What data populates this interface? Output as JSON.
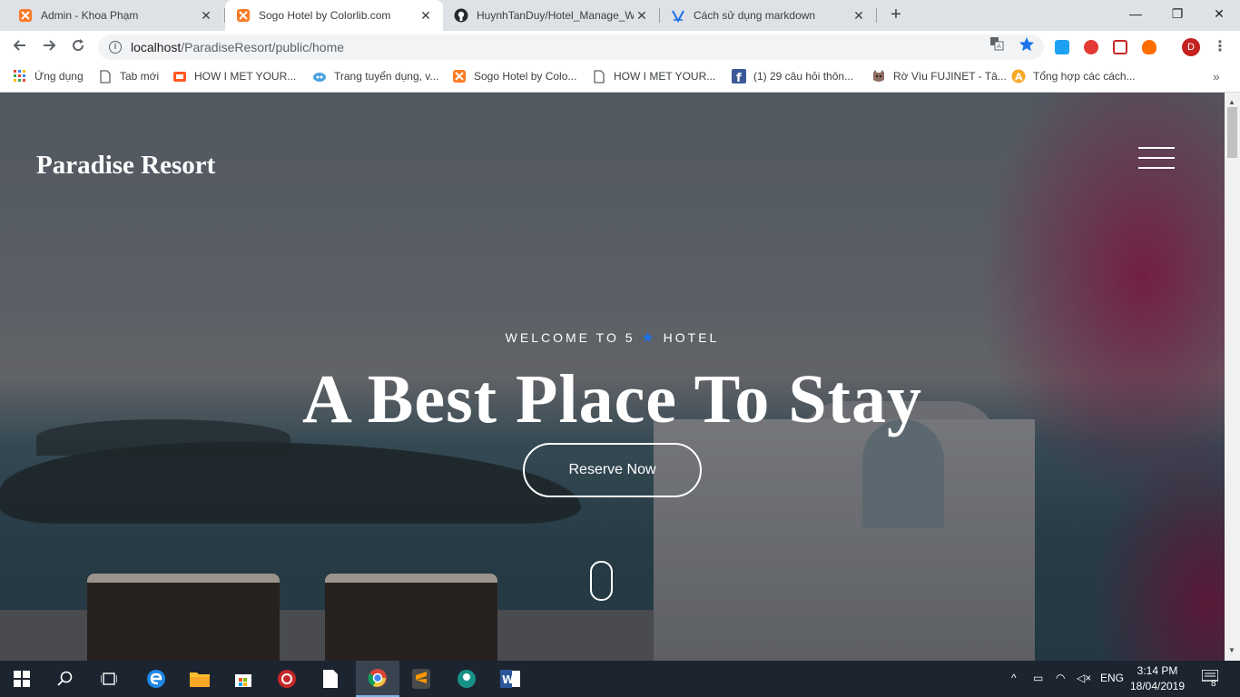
{
  "browser": {
    "tabs": [
      {
        "title": "Admin - Khoa Phạm",
        "favicon": "xampp-icon",
        "active": false
      },
      {
        "title": "Sogo Hotel by Colorlib.com",
        "favicon": "xampp-icon",
        "active": true
      },
      {
        "title": "HuynhTanDuy/Hotel_Manage_We",
        "favicon": "github-icon",
        "active": false
      },
      {
        "title": "Cách sử dụng markdown",
        "favicon": "viblo-icon",
        "active": false
      }
    ],
    "tab_close": "✕",
    "new_tab": "+",
    "window_controls": {
      "minimize": "—",
      "maximize": "❐",
      "close": "✕"
    },
    "url_host": "localhost",
    "url_path": "/ParadiseResort/public/home",
    "profile_initial": "D",
    "bookmarks": [
      {
        "label": "Ứng dụng",
        "icon": "apps-grid-icon"
      },
      {
        "label": "Tab mới",
        "icon": "page-icon"
      },
      {
        "label": "HOW I MET YOUR...",
        "icon": "film-icon"
      },
      {
        "label": "Trang tuyển dụng, v...",
        "icon": "cloud-icon"
      },
      {
        "label": "Sogo Hotel by Colo...",
        "icon": "xampp-icon"
      },
      {
        "label": "HOW I MET YOUR...",
        "icon": "page-icon"
      },
      {
        "label": "(1) 29 câu hỏi thôn...",
        "icon": "facebook-icon"
      },
      {
        "label": "Rờ Vìu FUJINET - Tâ...",
        "icon": "cat-icon"
      },
      {
        "label": "Tổng hợp các cách...",
        "icon": "a-badge-icon"
      }
    ],
    "bookmarks_more": "»"
  },
  "page": {
    "brand": "Paradise Resort",
    "welcome_prefix": "WELCOME TO 5",
    "welcome_star": "★",
    "welcome_suffix": "HOTEL",
    "headline": "A Best Place To Stay",
    "reserve_label": "Reserve Now"
  },
  "taskbar": {
    "language": "ENG",
    "time": "3:14 PM",
    "date": "18/04/2019",
    "notifications": "8"
  },
  "colors": {
    "accent_star": "#1a73e8",
    "taskbar": "#1c2430",
    "tabstrip": "#dee1e6"
  }
}
